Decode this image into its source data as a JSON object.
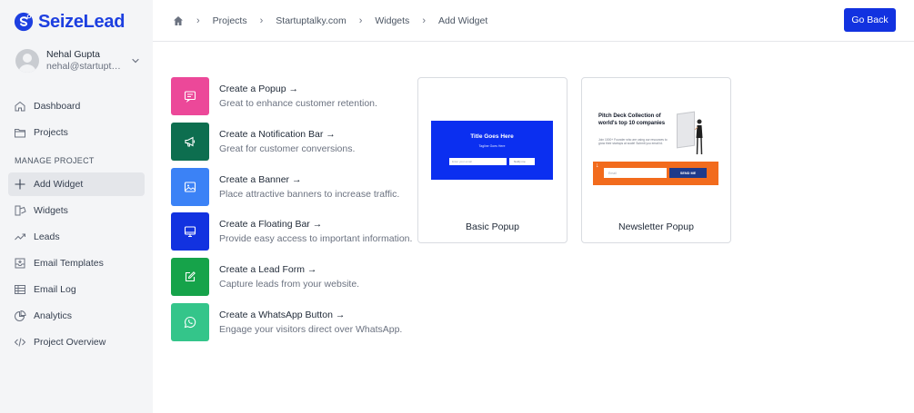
{
  "brand": {
    "name": "SeizeLead",
    "color": "#1d3fe0"
  },
  "user": {
    "name": "Nehal Gupta",
    "email": "nehal@startuptalky.com"
  },
  "sidebar": {
    "top_items": [
      {
        "label": "Dashboard",
        "icon": "home-icon"
      },
      {
        "label": "Projects",
        "icon": "folder-icon"
      }
    ],
    "section_title": "MANAGE PROJECT",
    "items": [
      {
        "label": "Add Widget",
        "icon": "plus-icon",
        "active": true
      },
      {
        "label": "Widgets",
        "icon": "widgets-icon"
      },
      {
        "label": "Leads",
        "icon": "trend-icon"
      },
      {
        "label": "Email Templates",
        "icon": "inbox-icon"
      },
      {
        "label": "Email Log",
        "icon": "list-icon"
      },
      {
        "label": "Analytics",
        "icon": "pie-chart-icon"
      },
      {
        "label": "Project Overview",
        "icon": "code-icon"
      }
    ]
  },
  "breadcrumb": [
    "Projects",
    "Startuptalky.com",
    "Widgets",
    "Add Widget"
  ],
  "header": {
    "go_back_label": "Go Back",
    "accent": "#1232e0"
  },
  "widgets": [
    {
      "title": "Create a Popup →",
      "desc": "Great to enhance customer retention.",
      "color": "#ec4899",
      "icon": "popup-icon"
    },
    {
      "title": "Create a Notification Bar →",
      "desc": "Great for customer conversions.",
      "color": "#0d6e4f",
      "icon": "megaphone-icon"
    },
    {
      "title": "Create a Banner →",
      "desc": "Place attractive banners to increase traffic.",
      "color": "#3b82f6",
      "icon": "image-icon"
    },
    {
      "title": "Create a Floating Bar →",
      "desc": "Provide easy access to important information.",
      "color": "#1232e0",
      "icon": "monitor-icon"
    },
    {
      "title": "Create a Lead Form →",
      "desc": "Capture leads from your website.",
      "color": "#16a34a",
      "icon": "edit-icon"
    },
    {
      "title": "Create a WhatsApp Button →",
      "desc": "Engage your visitors direct over WhatsApp.",
      "color": "#34c58a",
      "icon": "whatsapp-icon"
    }
  ],
  "templates": {
    "basic": {
      "label": "Basic Popup",
      "preview_title": "Title Goes Here",
      "preview_subtitle": "Tagline Goes Here",
      "preview_input": "Enter your email",
      "preview_button": "Notify me"
    },
    "newsletter": {
      "label": "Newsletter Popup",
      "preview_title": "Pitch Deck Collection of world's top 10 companies",
      "preview_text": "Join 1000+ Founder who are using our resources to grow their startups at scale! Submit you email id.",
      "preview_input": "Email",
      "preview_button": "SEND ME"
    }
  }
}
